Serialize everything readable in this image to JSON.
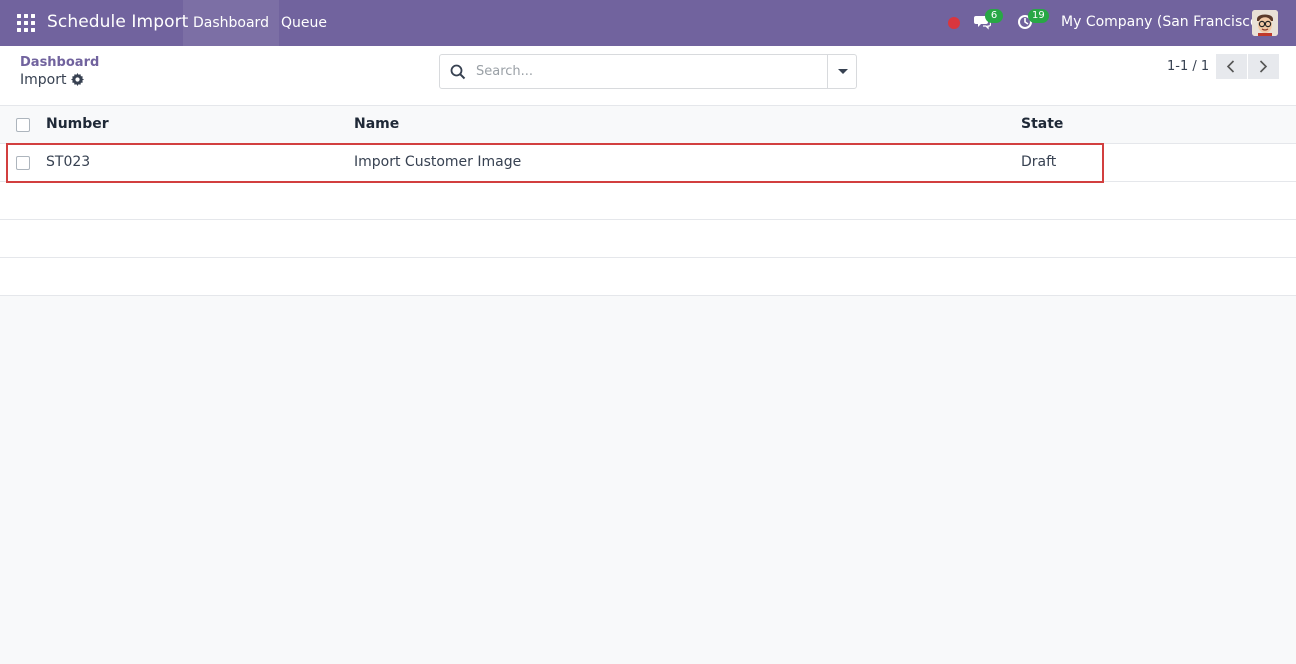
{
  "navbar": {
    "app_name": "Schedule Import",
    "menu": [
      "Dashboard",
      "Queue"
    ],
    "messages_count": "6",
    "activities_count": "19",
    "company": "My Company (San Francisco)"
  },
  "control_panel": {
    "breadcrumb_parent": "Dashboard",
    "breadcrumb_current": "Import",
    "search_placeholder": "Search...",
    "pager_value": "1-1 / 1"
  },
  "list": {
    "columns": [
      "Number",
      "Name",
      "State"
    ],
    "rows": [
      {
        "number": "ST023",
        "name": "Import Customer Image",
        "state": "Draft"
      }
    ]
  },
  "colors": {
    "brand": "#71639e",
    "badge": "#28a745",
    "highlight": "#d23f3f"
  }
}
